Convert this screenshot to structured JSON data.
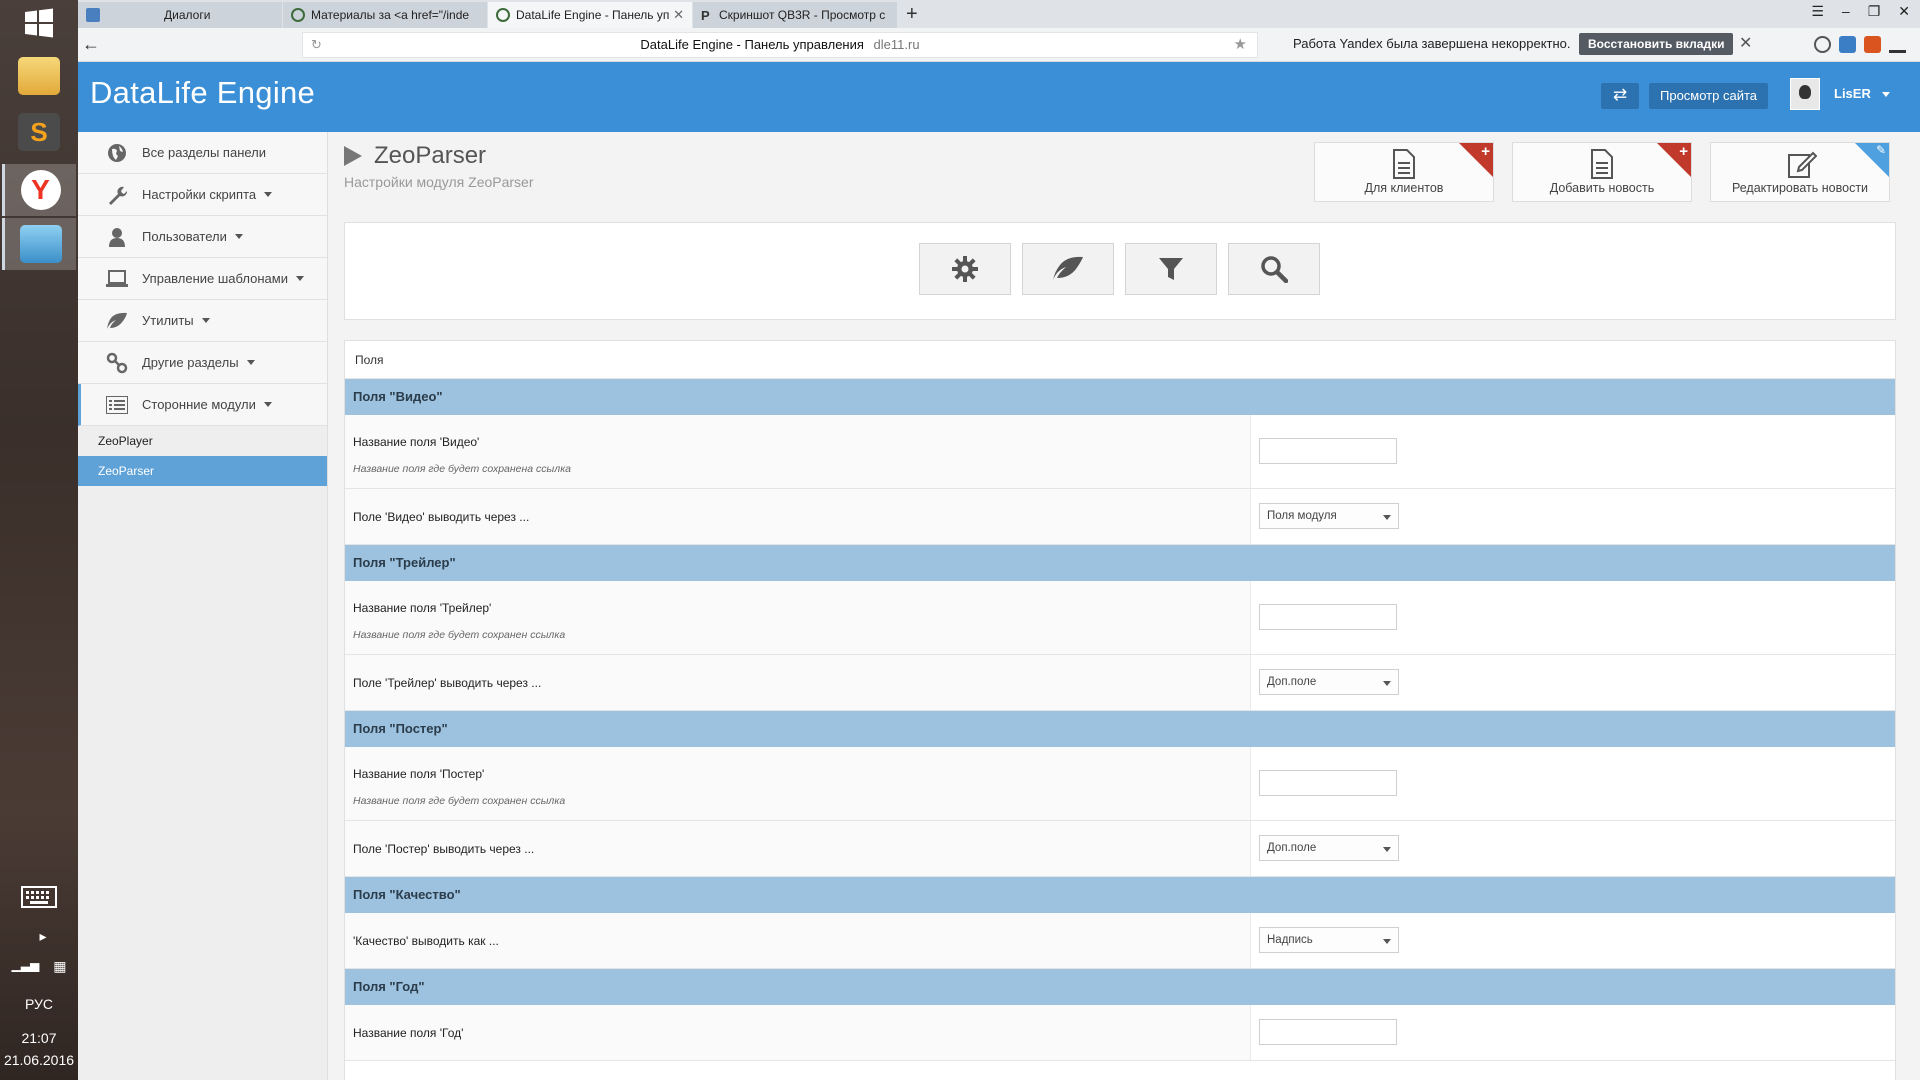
{
  "taskbar": {
    "lang": "РУС",
    "time": "21:07",
    "date": "21.06.2016"
  },
  "browser": {
    "tabs": [
      {
        "title": "Диалоги",
        "active": false
      },
      {
        "title": "Материалы за <a href=\"/inde",
        "active": false
      },
      {
        "title": "DataLife Engine - Панель уп",
        "active": true
      },
      {
        "title": "Скриншот QB3R - Просмотр с",
        "active": false
      }
    ],
    "new_tab": "+",
    "url_title": "DataLife Engine - Панель управления",
    "url_domain": "dle11.ru",
    "notice": "Работа Yandex была завершена некорректно.",
    "restore_label": "Восстановить вкладки"
  },
  "header": {
    "brand": "DataLife Engine",
    "swap_icon": "⇄",
    "view_site": "Просмотр сайта",
    "user": "LisER"
  },
  "sidebar": {
    "items": [
      {
        "label": "Все разделы панели",
        "icon": "globe-icon",
        "caret": false
      },
      {
        "label": "Настройки скрипта",
        "icon": "wrench-icon",
        "caret": true
      },
      {
        "label": "Пользователи",
        "icon": "user-icon",
        "caret": true
      },
      {
        "label": "Управление шаблонами",
        "icon": "monitor-icon",
        "caret": true
      },
      {
        "label": "Утилиты",
        "icon": "leaf-icon",
        "caret": true
      },
      {
        "label": "Другие разделы",
        "icon": "link-icon",
        "caret": true
      },
      {
        "label": "Сторонние модули",
        "icon": "list-icon",
        "caret": true
      }
    ],
    "subitems": [
      {
        "label": "ZeoPlayer",
        "active": false
      },
      {
        "label": "ZeoParser",
        "active": true
      }
    ]
  },
  "page": {
    "title": "ZeoParser",
    "subtitle": "Настройки модуля ZeoParser",
    "quick_buttons": [
      {
        "label": "Для клиентов",
        "icon": "document-icon",
        "corner": "+"
      },
      {
        "label": "Добавить новость",
        "icon": "document-icon",
        "corner": "+"
      },
      {
        "label": "Редактировать новости",
        "icon": "edit-icon",
        "corner": "✎"
      }
    ],
    "tools": [
      "gear-icon",
      "leaf-icon",
      "filter-icon",
      "search-icon"
    ]
  },
  "settings": {
    "panel_title": "Поля",
    "sections": [
      {
        "title": "Поля \"Видео\"",
        "rows": [
          {
            "label": "Название поля 'Видео'",
            "hint": "Название поля где будет сохранена ссылка",
            "type": "input",
            "value": ""
          },
          {
            "label": "Поле 'Видео' выводить через ...",
            "type": "select",
            "value": "Поля модуля"
          }
        ]
      },
      {
        "title": "Поля \"Трейлер\"",
        "rows": [
          {
            "label": "Название поля 'Трейлер'",
            "hint": "Название поля где будет сохранен ссылка",
            "type": "input",
            "value": ""
          },
          {
            "label": "Поле 'Трейлер' выводить через ...",
            "type": "select",
            "value": "Доп.поле"
          }
        ]
      },
      {
        "title": "Поля \"Постер\"",
        "rows": [
          {
            "label": "Название поля 'Постер'",
            "hint": "Название поля где будет сохранен ссылка",
            "type": "input",
            "value": ""
          },
          {
            "label": "Поле 'Постер' выводить через ...",
            "type": "select",
            "value": "Доп.поле"
          }
        ]
      },
      {
        "title": "Поля \"Качество\"",
        "rows": [
          {
            "label": "'Качество' выводить как ...",
            "type": "select",
            "value": "Надпись"
          }
        ]
      },
      {
        "title": "Поля \"Год\"",
        "rows": [
          {
            "label": "Название поля 'Год'",
            "type": "input",
            "value": ""
          }
        ]
      }
    ]
  }
}
